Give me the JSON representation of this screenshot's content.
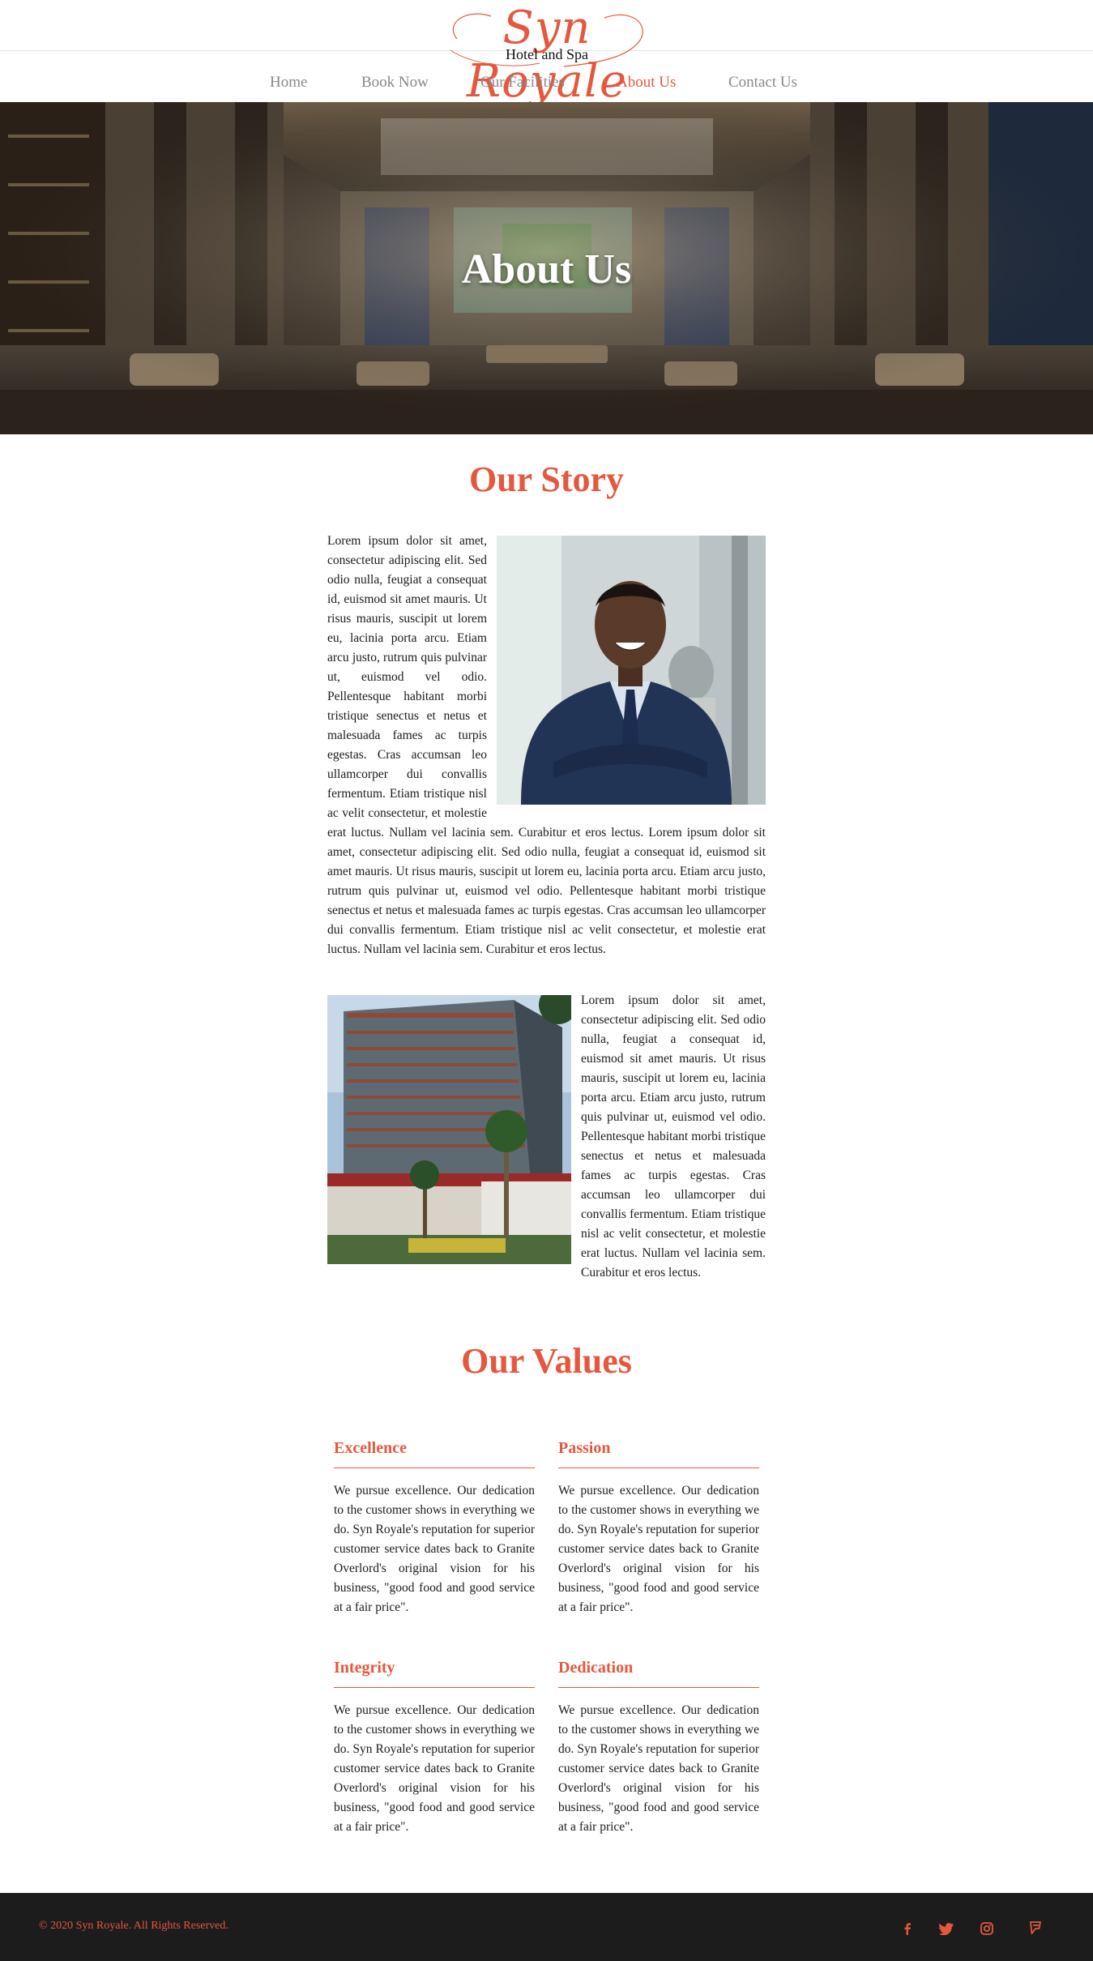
{
  "brand": {
    "name": "Syn Royale",
    "tagline": "Hotel and Spa",
    "accent_color": "#e5583e"
  },
  "nav": {
    "items": [
      {
        "label": "Home"
      },
      {
        "label": "Book Now"
      },
      {
        "label": "Our Facilities"
      },
      {
        "label": "About Us"
      },
      {
        "label": "Contact Us"
      }
    ],
    "active": "About Us"
  },
  "hero": {
    "title": "About Us",
    "image": "hotel-lobby-interior"
  },
  "story": {
    "heading": "Our Story",
    "paragraph_1": "Lorem ipsum dolor sit amet, consectetur adipiscing elit. Sed odio nulla, feugiat a consequat id, euismod sit amet mauris. Ut risus mauris, suscipit ut lorem eu, lacinia porta arcu. Etiam arcu justo, rutrum quis pulvinar ut, euismod vel odio. Pellentesque habitant morbi tristique senectus et netus et malesuada fames ac turpis egestas. Cras accumsan leo ullamcorper dui convallis fermentum. Etiam tristique nisl ac velit consectetur, et molestie erat luctus. Nullam vel lacinia sem. Curabitur et eros lectus. Lorem ipsum dolor sit amet, consectetur adipiscing elit. Sed odio nulla, feugiat a consequat id, euismod sit amet mauris. Ut risus mauris, suscipit ut lorem eu, lacinia porta arcu. Etiam arcu justo, rutrum quis pulvinar ut, euismod vel odio. Pellentesque habitant morbi tristique senectus et netus et malesuada fames ac turpis egestas. Cras accumsan leo ullamcorper dui convallis fermentum. Etiam tristique nisl ac velit consectetur, et molestie erat luctus. Nullam vel lacinia sem. Curabitur et eros lectus.",
    "paragraph_2": "Lorem ipsum dolor sit amet, consectetur adipiscing elit. Sed odio nulla, feugiat a consequat id, euismod sit amet mauris. Ut risus mauris, suscipit ut lorem eu, lacinia porta arcu. Etiam arcu justo, rutrum quis pulvinar ut, euismod vel odio. Pellentesque habitant morbi tristique senectus et netus et malesuada fames ac turpis egestas. Cras accumsan leo ullamcorper dui convallis fermentum. Etiam tristique nisl ac velit consectetur, et molestie erat luctus. Nullam vel lacinia sem. Curabitur et eros lectus.",
    "image_1": "businessman-portrait",
    "image_2": "hotel-building-exterior"
  },
  "values": {
    "heading": "Our Values",
    "items": [
      {
        "title": "Excellence",
        "body": "We pursue excellence. Our dedication to the customer shows in everything we do. Syn Royale's reputation for superior customer service dates back to Granite Overlord's original vision for his business, \"good food and good service at a fair price\"."
      },
      {
        "title": "Passion",
        "body": "We pursue excellence. Our dedication to the customer shows in everything we do. Syn Royale's reputation for superior customer service dates back to Granite Overlord's original vision for his business, \"good food and good service at a fair price\"."
      },
      {
        "title": "Integrity",
        "body": "We pursue excellence. Our dedication to the customer shows in everything we do. Syn Royale's reputation for superior customer service dates back to Granite Overlord's original vision for his business, \"good food and good service at a fair price\"."
      },
      {
        "title": "Dedication",
        "body": "We pursue excellence. Our dedication to the customer shows in everything we do. Syn Royale's reputation for superior customer service dates back to Granite Overlord's original vision for his business, \"good food and good service at a fair price\"."
      }
    ]
  },
  "footer": {
    "copyright": "© 2020 Syn Royale. All Rights Reserved.",
    "social_icons": [
      "facebook-icon",
      "twitter-icon",
      "instagram-icon",
      "foursquare-icon"
    ]
  }
}
